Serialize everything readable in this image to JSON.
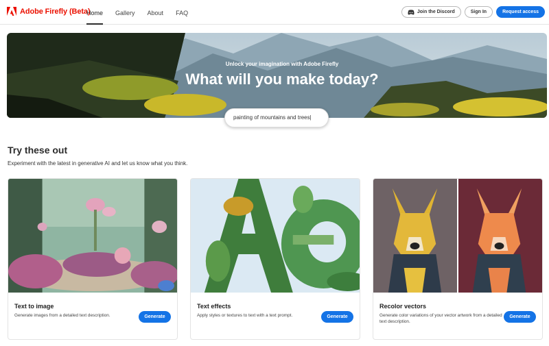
{
  "brand": {
    "name": "Adobe Firefly (Beta)",
    "logo_icon": "adobe-logo-icon",
    "color": "#eb1000"
  },
  "nav": {
    "items": [
      {
        "label": "Home",
        "active": true
      },
      {
        "label": "Gallery"
      },
      {
        "label": "About"
      },
      {
        "label": "FAQ"
      }
    ]
  },
  "actions": {
    "discord_label": "Join the Discord",
    "discord_icon": "discord-icon",
    "signin_label": "Sign In",
    "request_label": "Request access",
    "accent": "#1473e6"
  },
  "hero": {
    "subtitle": "Unlock your imagination with Adobe Firefly",
    "title": "What will you make today?",
    "search_value": "painting of mountains and trees|"
  },
  "section": {
    "title": "Try these out",
    "description": "Experiment with the latest in generative AI and let us know what you think."
  },
  "cards": [
    {
      "title": "Text to image",
      "description": "Generate images from a detailed text description.",
      "button": "Generate"
    },
    {
      "title": "Text effects",
      "description": "Apply styles or textures to text with a text prompt.",
      "button": "Generate"
    },
    {
      "title": "Recolor vectors",
      "description": "Generate color variations of your vector artwork from a detailed text description.",
      "button": "Generate"
    }
  ]
}
